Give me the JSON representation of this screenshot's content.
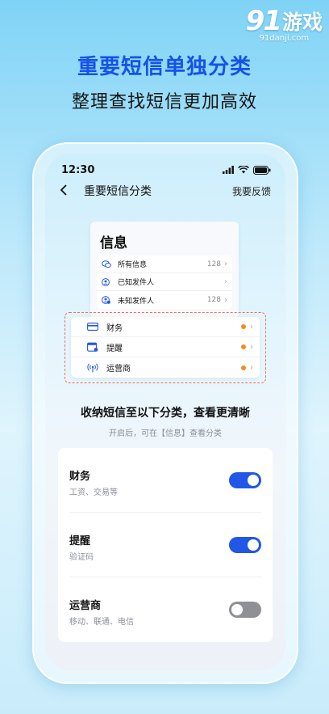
{
  "watermark": {
    "number": "91",
    "text": "游戏",
    "url": "91danji.com"
  },
  "hero": {
    "headline": "重要短信单独分类",
    "subline": "整理查找短信更加高效"
  },
  "status_bar": {
    "time": "12:30"
  },
  "nav": {
    "title": "重要短信分类",
    "feedback": "我要反馈"
  },
  "preview": {
    "title": "信息",
    "rows": [
      {
        "icon": "chat-bubbles-icon",
        "label": "所有信息",
        "count": "128"
      },
      {
        "icon": "person-icon",
        "label": "已知发件人",
        "count": ""
      },
      {
        "icon": "unknown-person-icon",
        "label": "未知发件人",
        "count": "128"
      }
    ]
  },
  "highlight": {
    "rows": [
      {
        "icon": "card-icon",
        "label": "财务"
      },
      {
        "icon": "calendar-icon",
        "label": "提醒"
      },
      {
        "icon": "antenna-icon",
        "label": "运营商"
      }
    ],
    "dot_color": "#f58a1f"
  },
  "section": {
    "title": "收纳短信至以下分类，查看更清晰",
    "subtitle": "开启后，可在【信息】查看分类"
  },
  "settings": [
    {
      "name": "财务",
      "desc": "工资、交易等",
      "enabled": true
    },
    {
      "name": "提醒",
      "desc": "验证码",
      "enabled": true
    },
    {
      "name": "运营商",
      "desc": "移动、联通、电信",
      "enabled": false
    }
  ],
  "colors": {
    "accent": "#2157e6",
    "headline": "#1552e8",
    "toggle_off": "#8f9095"
  }
}
